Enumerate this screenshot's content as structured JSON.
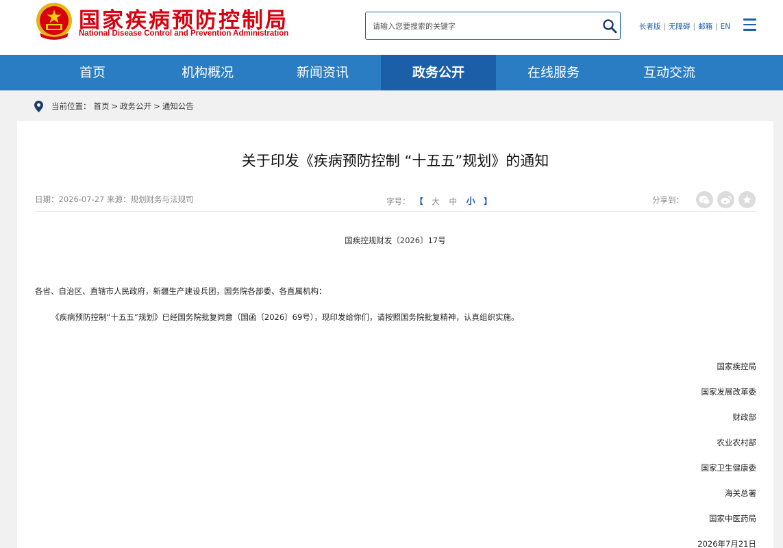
{
  "header": {
    "logo_cn": "国家疾病预防控制局",
    "logo_en": "National Disease Control and Prevention Administration",
    "search_placeholder": "请输入您要搜索的关键字",
    "links": [
      "长者版",
      "无障碍",
      "邮箱",
      "EN"
    ]
  },
  "nav": {
    "items": [
      "首页",
      "机构概况",
      "新闻资讯",
      "政务公开",
      "在线服务",
      "互动交流"
    ],
    "active": "政务公开"
  },
  "breadcrumb": {
    "label": "当前位置：",
    "items": [
      "首页",
      "政务公开",
      "通知公告"
    ],
    "separator": ">"
  },
  "article": {
    "title": "关于印发《疾病预防控制 “十五五”规划》的通知",
    "date_label": "日期：",
    "date": "2026-07-27",
    "source_label": "来源：",
    "source": "规划财务与法规司",
    "font_size_label": "字号：",
    "font_sizes": [
      "大",
      "中",
      "小"
    ],
    "share_label": "分享到：",
    "doc_number": "国疾控规财发〔2026〕17号",
    "addressee": "各省、自治区、直辖市人民政府，新疆生产建设兵团，国务院各部委、各直属机构：",
    "body": "《疾病预防控制“十五五”规划》已经国务院批复同意（国函〔2026〕69号），现印发给你们，请按照国务院批复精神，认真组织实施。",
    "signers": [
      "国家疾控局",
      "国家发展改革委",
      "财政部",
      "农业农村部",
      "国家卫生健康委",
      "海关总署",
      "国家中医药局"
    ],
    "sign_date": "2026年7月21日"
  },
  "colors": {
    "brand_red": "#d7000f",
    "nav_blue": "#2a7dc2",
    "nav_active": "#1a5fa8"
  }
}
